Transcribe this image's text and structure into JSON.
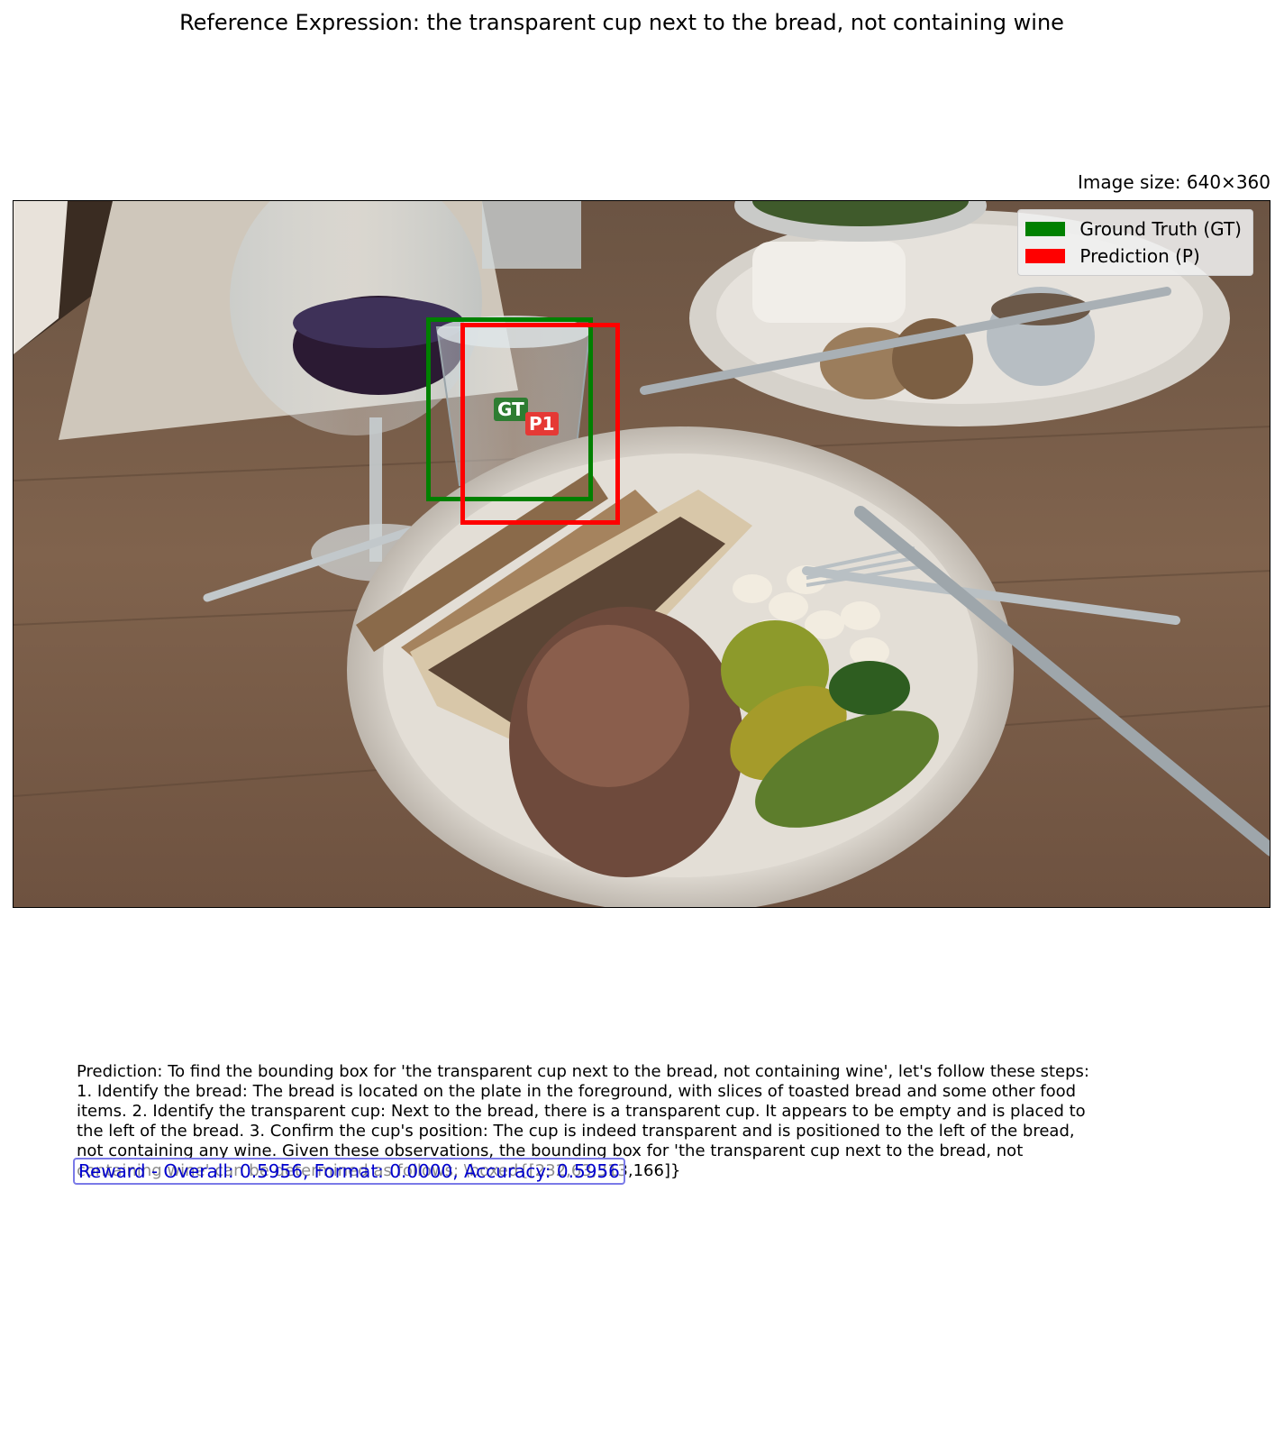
{
  "header": {
    "title": "Reference Expression: the transparent cup next to the bread, not containing wine",
    "image_size": "Image size: 640×360"
  },
  "annotations": {
    "gt_tag": "GT",
    "pred_tag": "P1",
    "gt_color": "#008000",
    "pred_color": "#ff0000"
  },
  "legend": {
    "items": [
      {
        "label": "Ground Truth (GT)",
        "color": "#008000"
      },
      {
        "label": "Prediction (P)",
        "color": "#ff0000"
      }
    ]
  },
  "prediction": {
    "text": "Prediction: To find the bounding box for 'the transparent cup next to the bread, not containing wine', let's follow these steps:  1. Identify the bread: The bread is located on the plate in the foreground, with slices of toasted bread and some other food items. 2. Identify the transparent cup: Next to the bread, there is a transparent cup. It appears to be empty and is placed to the left of the bread. 3. Confirm the cup's position: The cup is indeed transparent and is positioned to the left of the bread, not containing any wine.  Given these observations, the bounding box for 'the transparent cup next to the bread, not containing wine' can be determined as follows:  \\boxed{[232,63,313,166]}"
  },
  "reward": {
    "text": "Reward - Overall: 0.5956, Format: 0.0000, Accuracy: 0.5956"
  }
}
